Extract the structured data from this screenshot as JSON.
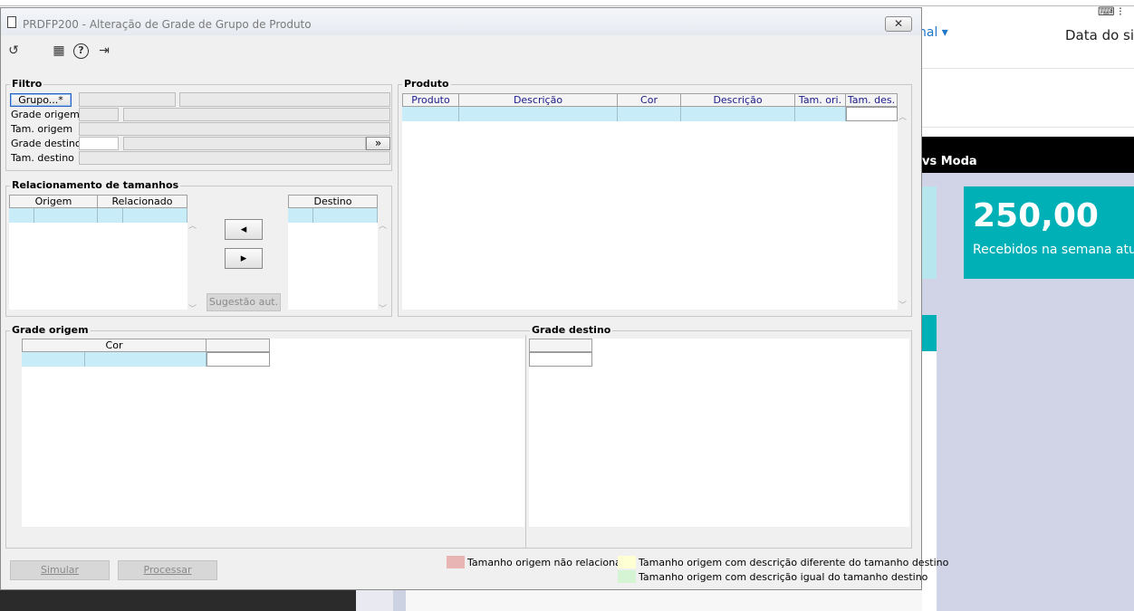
{
  "background": {
    "menu_label": "nal",
    "menu_caret": "▾",
    "date_label": "Data do sist",
    "black_bar_text": "vs Moda",
    "card_value": "250,00",
    "card_label": "Recebidos na semana atua",
    "card_color": "#00b0b7"
  },
  "dialog": {
    "title": "PRDFP200 - Alteração de Grade de Grupo de Produto",
    "close_label": "✕"
  },
  "toolbar": {
    "icons": [
      "refresh-icon",
      "calendar-icon",
      "help-icon",
      "exit-icon"
    ],
    "refresh_glyph": "↺",
    "calendar_glyph": "▦",
    "help_glyph": "?",
    "exit_glyph": "⇥"
  },
  "filtro": {
    "title": "Filtro",
    "grupo_button": "Grupo...*",
    "grade_origem": "Grade origem",
    "tam_origem": "Tam. origem",
    "grade_destino": "Grade destino",
    "tam_destino": "Tam. destino",
    "browse_button": "»"
  },
  "produto": {
    "title": "Produto",
    "columns": [
      "Produto",
      "Descrição",
      "Cor",
      "Descrição",
      "Tam. ori.",
      "Tam. des."
    ]
  },
  "relacionamento": {
    "title": "Relacionamento de tamanhos",
    "origem_columns": [
      "Origem",
      "Relacionado"
    ],
    "destino_columns": [
      "Destino"
    ],
    "left_arrow": "◂",
    "right_arrow": "▸",
    "sugestao_button": "Sugestão aut."
  },
  "grade_origem": {
    "title": "Grade origem",
    "columns": [
      "Cor",
      ""
    ]
  },
  "grade_destino": {
    "title": "Grade destino"
  },
  "footer": {
    "simular_button": "Simular",
    "processar_button": "Processar",
    "legend": [
      {
        "text": "Tamanho origem não relacionado",
        "color": "#e8b4b4"
      },
      {
        "text": "Tamanho origem com descrição diferente do tamanho destino",
        "color": "#ffffd4"
      },
      {
        "text": "Tamanho origem com descrição igual do tamanho destino",
        "color": "#d4f4d4"
      }
    ]
  }
}
